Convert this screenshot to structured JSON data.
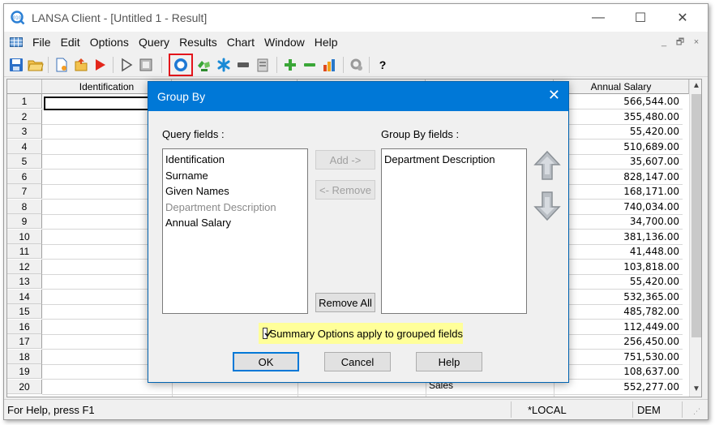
{
  "window": {
    "title": "LANSA Client - [Untitled 1 - Result]",
    "caption_buttons": {
      "minimize": "—",
      "maximize": "☐",
      "close": "✕"
    }
  },
  "menu": {
    "items": [
      "File",
      "Edit",
      "Options",
      "Query",
      "Results",
      "Chart",
      "Window",
      "Help"
    ],
    "mdi": {
      "minimize": "_",
      "restore": "🗗",
      "close": "×"
    }
  },
  "toolbar": {
    "help_label": "?",
    "icons": [
      "save-icon",
      "open-folder-icon",
      "new-document-icon",
      "open-document-icon",
      "run-icon",
      "play-icon",
      "stop-icon",
      "group-by-icon",
      "recycle-icon",
      "asterisk-icon",
      "minus-block-icon",
      "clipboard-icon",
      "add-row-icon",
      "remove-row-icon",
      "chart-icon",
      "settings-icon",
      "help-icon"
    ],
    "selected": "group-by-icon",
    "highlight_color": "#e3141b"
  },
  "grid": {
    "headers": {
      "identification": "Identification",
      "annual_salary": "Annual Salary"
    },
    "rows": [
      {
        "n": "1",
        "salary": "566,544.00"
      },
      {
        "n": "2",
        "salary": "355,480.00"
      },
      {
        "n": "3",
        "salary": "55,420.00"
      },
      {
        "n": "4",
        "salary": "510,689.00"
      },
      {
        "n": "5",
        "salary": "35,607.00"
      },
      {
        "n": "6",
        "salary": "828,147.00"
      },
      {
        "n": "7",
        "salary": "168,171.00"
      },
      {
        "n": "8",
        "salary": "740,034.00"
      },
      {
        "n": "9",
        "salary": "34,700.00"
      },
      {
        "n": "10",
        "salary": "381,136.00"
      },
      {
        "n": "11",
        "salary": "41,448.00"
      },
      {
        "n": "12",
        "salary": "103,818.00"
      },
      {
        "n": "13",
        "salary": "55,420.00"
      },
      {
        "n": "14",
        "salary": "532,365.00"
      },
      {
        "n": "15",
        "salary": "485,782.00"
      },
      {
        "n": "16",
        "salary": "112,449.00"
      },
      {
        "n": "17",
        "salary": "256,450.00"
      },
      {
        "n": "18",
        "salary": "751,530.00"
      },
      {
        "n": "19",
        "salary": "108,637.00"
      },
      {
        "n": "20",
        "salary": "552,277.00"
      }
    ],
    "partial_cell": "Sales"
  },
  "status": {
    "help": "For Help, press F1",
    "location": "*LOCAL",
    "mode": "DEM"
  },
  "dialog": {
    "title": "Group By",
    "close": "✕",
    "query_fields_label": "Query fields :",
    "group_by_fields_label": "Group By fields :",
    "query_fields": [
      {
        "label": "Identification",
        "disabled": false
      },
      {
        "label": "Surname",
        "disabled": false
      },
      {
        "label": "Given Names",
        "disabled": false
      },
      {
        "label": "Department Description",
        "disabled": true
      },
      {
        "label": "Annual Salary",
        "disabled": false
      }
    ],
    "group_by_fields": [
      "Department Description"
    ],
    "add_button": "Add ->",
    "remove_button": "<- Remove",
    "remove_all_button": "Remove All",
    "summary_checkbox": {
      "label": "Summary Options apply to grouped fields",
      "checked": true
    },
    "highlight_color": "#ffff99",
    "ok_button": "OK",
    "cancel_button": "Cancel",
    "help_button": "Help"
  }
}
